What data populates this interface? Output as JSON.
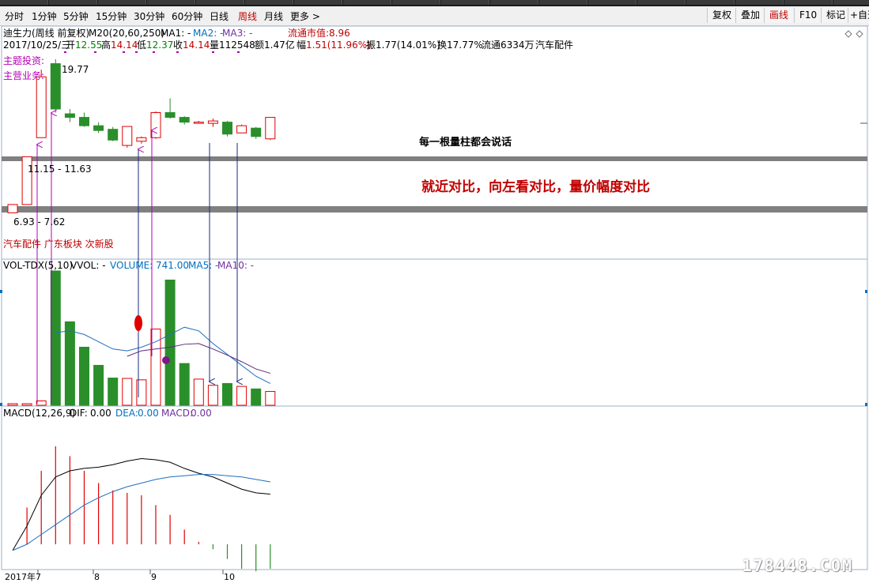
{
  "toolbar": {
    "periods": [
      "分时",
      "1分钟",
      "5分钟",
      "15分钟",
      "30分钟",
      "60分钟",
      "日线",
      "周线",
      "月线",
      "更多 >"
    ],
    "active_period": "周线",
    "right_buttons": [
      "复权",
      "叠加",
      "画线",
      "F10",
      "标记",
      "+自选"
    ],
    "active_right": "画线"
  },
  "header": {
    "name": "迪生力(周线 前复权)",
    "m20": "M20(20,60,250)",
    "ma1": "MA1: -",
    "ma2": "MA2: -",
    "ma3": "MA3: -",
    "float_mv_label": "流通市值:",
    "float_mv": "8.96",
    "date": "2017/10/25/三",
    "open_label": "开",
    "open": "12.55",
    "high_label": "高",
    "high": "14.14",
    "low_label": "低",
    "low": "12.37",
    "close_label": "收",
    "close": "14.14",
    "vol_label": "量",
    "vol": "112548",
    "amt_label": "额",
    "amt": "1.47亿",
    "chg_label": "幅",
    "chg": "1.51(11.96%)",
    "amp_label": "振",
    "amp": "1.77(14.01%)",
    "turn_label": "换",
    "turn": "17.77%",
    "float_label": "流通",
    "float": "6334万",
    "industry": "汽车配件"
  },
  "price_panel": {
    "label_theme": "主题投资:",
    "label_business": "主营业务:",
    "max_price_label": "19.77",
    "zone_upper_label": "11.15 - 11.63",
    "zone_lower_label": "6.93 - 7.62",
    "tags": "汽车配件 广东板块 次新股",
    "annotation_1": "每一根量柱都会说话",
    "annotation_2": "就近对比，向左看对比，量价幅度对比"
  },
  "vol_panel": {
    "header_name": "VOL-TDX(5,10)",
    "vvol": "VVOL: -",
    "volume_label": "VOLUME:",
    "volume": "741.00",
    "ma5": "MA5: -",
    "ma10": "MA10: -"
  },
  "macd_panel": {
    "header_name": "MACD(12,26,9)",
    "dif_label": "DIF:",
    "dif": "0.00",
    "dea_label": "DEA:",
    "dea": "0.00",
    "macd_label": "MACD:",
    "macd": "0.00"
  },
  "axis": {
    "labels": [
      "2017年7",
      "8",
      "9",
      "10"
    ]
  },
  "colors": {
    "up": "#e00000",
    "down": "#2a8f2a",
    "dif_line": "#000000",
    "dea_line": "#1f6fbf",
    "ma5_line": "#1f6fbf",
    "ma10_line": "#5a2a7a",
    "zone_band": "#808080",
    "arrow_magenta": "#b400b4",
    "arrow_navy": "#1a2a80",
    "annotation_red": "#e00000"
  },
  "chart_data": {
    "type": "candlestick",
    "weeks": [
      {
        "o": 6.9,
        "h": 7.6,
        "l": 6.9,
        "c": 7.6,
        "vol": 3,
        "up": true
      },
      {
        "o": 7.6,
        "h": 11.6,
        "l": 7.6,
        "c": 11.6,
        "vol": 3,
        "up": true
      },
      {
        "o": 13.2,
        "h": 18.9,
        "l": 13.2,
        "c": 18.3,
        "vol": 12,
        "up": true
      },
      {
        "o": 19.4,
        "h": 19.77,
        "l": 15.3,
        "c": 15.6,
        "vol": 370,
        "up": false
      },
      {
        "o": 15.2,
        "h": 15.6,
        "l": 14.5,
        "c": 14.9,
        "vol": 230,
        "up": false
      },
      {
        "o": 14.9,
        "h": 15.3,
        "l": 14.1,
        "c": 14.2,
        "vol": 160,
        "up": false
      },
      {
        "o": 14.2,
        "h": 14.5,
        "l": 13.6,
        "c": 13.8,
        "vol": 110,
        "up": false
      },
      {
        "o": 13.9,
        "h": 14.1,
        "l": 12.9,
        "c": 13.0,
        "vol": 75,
        "up": false
      },
      {
        "o": 12.55,
        "h": 14.14,
        "l": 12.37,
        "c": 14.14,
        "vol": 74,
        "up": true
      },
      {
        "o": 12.9,
        "h": 13.3,
        "l": 12.7,
        "c": 13.2,
        "vol": 70,
        "up": true
      },
      {
        "o": 13.2,
        "h": 15.4,
        "l": 13.1,
        "c": 15.3,
        "vol": 210,
        "up": true
      },
      {
        "o": 15.3,
        "h": 16.5,
        "l": 14.8,
        "c": 14.9,
        "vol": 345,
        "up": false
      },
      {
        "o": 14.9,
        "h": 15.0,
        "l": 14.3,
        "c": 14.5,
        "vol": 115,
        "up": false
      },
      {
        "o": 14.5,
        "h": 14.6,
        "l": 14.4,
        "c": 14.5,
        "vol": 72,
        "up": true
      },
      {
        "o": 14.4,
        "h": 14.8,
        "l": 14.1,
        "c": 14.6,
        "vol": 55,
        "up": true
      },
      {
        "o": 14.5,
        "h": 14.6,
        "l": 13.3,
        "c": 13.5,
        "vol": 60,
        "up": false
      },
      {
        "o": 13.6,
        "h": 14.3,
        "l": 13.6,
        "c": 14.2,
        "vol": 52,
        "up": true
      },
      {
        "o": 14.0,
        "h": 14.1,
        "l": 13.1,
        "c": 13.3,
        "vol": 45,
        "up": false
      },
      {
        "o": 13.1,
        "h": 14.9,
        "l": 13.0,
        "c": 14.9,
        "vol": 38,
        "up": true
      }
    ],
    "ma5": [
      200,
      205,
      195,
      175,
      155,
      150,
      160,
      175,
      195,
      215,
      205,
      170,
      140,
      110,
      80,
      60
    ],
    "ma10": [
      135,
      150,
      155,
      160,
      168,
      170,
      155,
      138,
      120,
      100,
      88
    ],
    "dif": [
      -0.05,
      0.15,
      0.4,
      0.55,
      0.6,
      0.62,
      0.63,
      0.65,
      0.68,
      0.7,
      0.69,
      0.67,
      0.62,
      0.58,
      0.55,
      0.5,
      0.45,
      0.42,
      0.41
    ],
    "dea": [
      -0.05,
      0.0,
      0.08,
      0.16,
      0.24,
      0.32,
      0.38,
      0.43,
      0.47,
      0.5,
      0.53,
      0.55,
      0.56,
      0.57,
      0.57,
      0.56,
      0.55,
      0.53,
      0.51
    ],
    "macd": [
      0.0,
      0.3,
      0.6,
      0.8,
      0.72,
      0.6,
      0.5,
      0.44,
      0.42,
      0.4,
      0.32,
      0.24,
      0.12,
      0.02,
      -0.04,
      -0.12,
      -0.2,
      -0.22,
      -0.2
    ],
    "zones": [
      {
        "name": "upper",
        "low": 11.15,
        "high": 11.63
      },
      {
        "name": "lower",
        "low": 6.93,
        "high": 7.62
      }
    ]
  }
}
